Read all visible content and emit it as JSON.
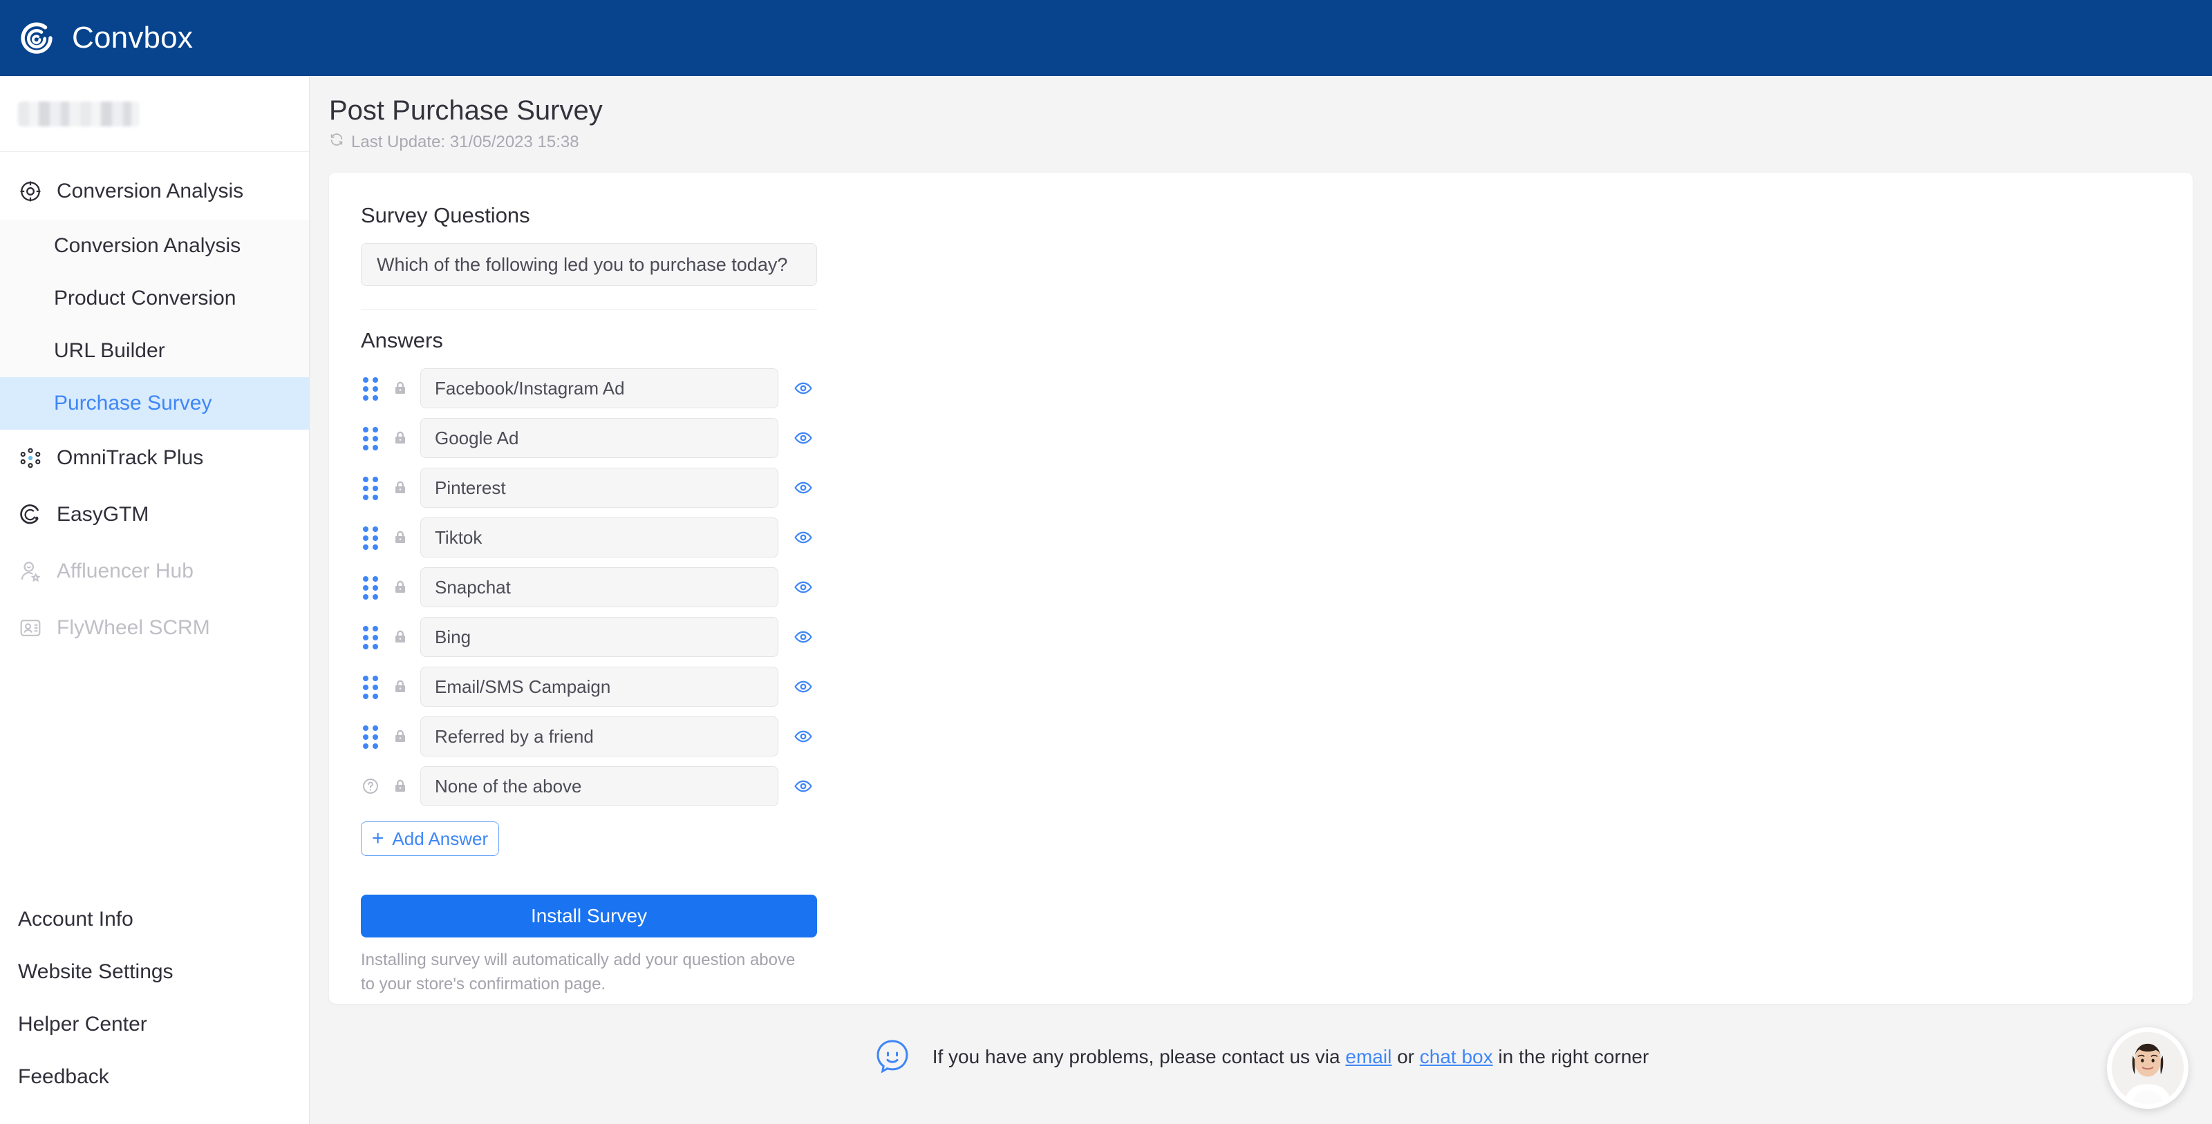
{
  "header": {
    "brand": "Convbox",
    "logo_icon": "spiral-logo-icon",
    "bg_color": "#08438d"
  },
  "sidebar": {
    "account_redacted": true,
    "nav": [
      {
        "label": "Conversion Analysis",
        "icon": "target-icon",
        "disabled": false
      },
      {
        "label": "OmniTrack Plus",
        "icon": "dots-circle-icon",
        "disabled": false
      },
      {
        "label": "EasyGTM",
        "icon": "circle-arc-icon",
        "disabled": false
      },
      {
        "label": "Affluencer Hub",
        "icon": "user-star-icon",
        "disabled": true
      },
      {
        "label": "FlyWheel SCRM",
        "icon": "contact-card-icon",
        "disabled": true
      }
    ],
    "subnav": [
      {
        "label": "Conversion Analysis",
        "active": false
      },
      {
        "label": "Product Conversion",
        "active": false
      },
      {
        "label": "URL Builder",
        "active": false
      },
      {
        "label": "Purchase Survey",
        "active": true
      }
    ],
    "bottom_links": [
      {
        "label": "Account Info"
      },
      {
        "label": "Website Settings"
      },
      {
        "label": "Helper Center"
      },
      {
        "label": "Feedback"
      }
    ]
  },
  "page": {
    "title": "Post Purchase Survey",
    "last_update_icon": "refresh-icon",
    "last_update": "Last Update: 31/05/2023 15:38"
  },
  "survey": {
    "questions_label": "Survey Questions",
    "question_value": "Which of the following led you to purchase today?",
    "answers_label": "Answers",
    "answers": [
      {
        "value": "Facebook/Instagram Ad",
        "lead_icon": "drag-handle-icon",
        "lock_icon": "lock-icon",
        "eye_icon": "eye-icon"
      },
      {
        "value": "Google Ad",
        "lead_icon": "drag-handle-icon",
        "lock_icon": "lock-icon",
        "eye_icon": "eye-icon"
      },
      {
        "value": "Pinterest",
        "lead_icon": "drag-handle-icon",
        "lock_icon": "lock-icon",
        "eye_icon": "eye-icon"
      },
      {
        "value": "Tiktok",
        "lead_icon": "drag-handle-icon",
        "lock_icon": "lock-icon",
        "eye_icon": "eye-icon"
      },
      {
        "value": "Snapchat",
        "lead_icon": "drag-handle-icon",
        "lock_icon": "lock-icon",
        "eye_icon": "eye-icon"
      },
      {
        "value": "Bing",
        "lead_icon": "drag-handle-icon",
        "lock_icon": "lock-icon",
        "eye_icon": "eye-icon"
      },
      {
        "value": "Email/SMS Campaign",
        "lead_icon": "drag-handle-icon",
        "lock_icon": "lock-icon",
        "eye_icon": "eye-icon"
      },
      {
        "value": "Referred by a friend",
        "lead_icon": "drag-handle-icon",
        "lock_icon": "lock-icon",
        "eye_icon": "eye-icon"
      },
      {
        "value": "None of the above",
        "lead_icon": "help-circle-icon",
        "lock_icon": "lock-icon",
        "eye_icon": "eye-icon"
      }
    ],
    "add_answer_label": "Add Answer",
    "add_answer_plus": "+",
    "install_label": "Install Survey",
    "install_note": "Installing survey will automatically add your question above to your store's confirmation page."
  },
  "footer": {
    "smiley_icon": "smiley-chat-icon",
    "text_before": "If you have any problems, please contact us via ",
    "link_email": "email",
    "text_middle": " or ",
    "link_chat": "chat box",
    "text_after": " in the right corner",
    "chat_widget_icon": "support-avatar-icon"
  },
  "colors": {
    "brand_blue": "#08438d",
    "accent_blue": "#3f86f7",
    "button_blue": "#1a73f0",
    "active_bg": "#d9ecfd"
  }
}
